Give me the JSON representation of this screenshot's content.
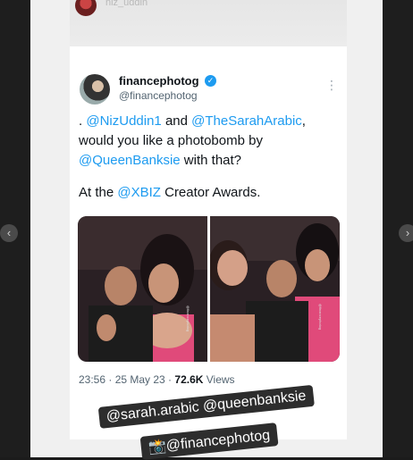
{
  "top_card": {
    "handle": "niz_uddin"
  },
  "tweet": {
    "display_name": "financephotog",
    "verified_icon": "verified-badge-icon",
    "handle": "@financephotog",
    "more_label": "⋮",
    "line1": {
      "prefix": ". ",
      "mention1": "@NizUddin1",
      "middle": " and ",
      "mention2": "@TheSarahArabic",
      "suffix": ","
    },
    "line2": "would you like a photobomb by",
    "line3": {
      "mention": "@QueenBanksie",
      "suffix": " with that?"
    },
    "line4": {
      "prefix": "At the ",
      "mention": "@XBIZ",
      "suffix": "  Creator Awards."
    },
    "photo_watermark": "@financephotog",
    "meta": {
      "time_date": "23:56 · 25 May 23 · ",
      "views_count": "72.6K",
      "views_label": " Views"
    }
  },
  "stickers": {
    "line1": "@sarah.arabic @queenbanksie",
    "line2_emoji": "📸",
    "line2_text": "@financephotog"
  },
  "nav": {
    "prev": "‹",
    "next": "›"
  },
  "colors": {
    "mention": "#1d9bf0",
    "verified": "#1d9bf0",
    "sticker_bg": "#2d2d2d"
  }
}
